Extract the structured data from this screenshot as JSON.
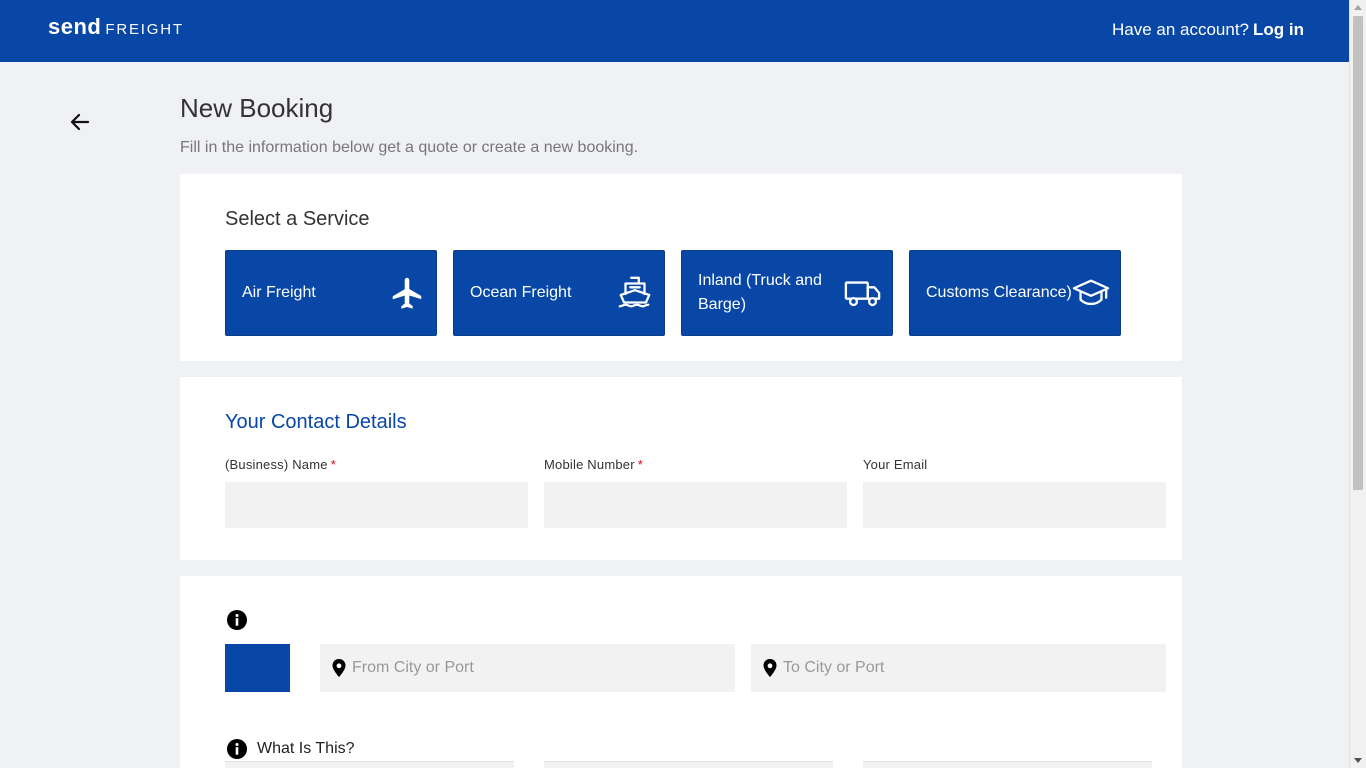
{
  "header": {
    "logo_send": "send",
    "logo_freight": "FREIGHT",
    "account_prompt": "Have an account?",
    "login_label": "Log in"
  },
  "page": {
    "title": "New Booking",
    "subtitle": "Fill in the information below get a quote or create a new booking."
  },
  "services": {
    "title": "Select a Service",
    "items": [
      {
        "label": "Air Freight",
        "icon": "airplane-icon"
      },
      {
        "label": "Ocean Freight",
        "icon": "ship-icon"
      },
      {
        "label": "Inland (Truck and Barge)",
        "icon": "truck-icon"
      },
      {
        "label": "Customs Clearance)",
        "icon": "graduation-cap-icon"
      }
    ]
  },
  "contact": {
    "title": "Your Contact Details",
    "name_label": "(Business) Name",
    "name_value": "",
    "mobile_label": "Mobile Number",
    "mobile_value": "",
    "email_label": "Your Email",
    "email_value": "",
    "required_marker": "*"
  },
  "route": {
    "from_placeholder": "From City or Port",
    "to_placeholder": "To City or Port",
    "what_label": "What Is This?"
  },
  "colors": {
    "brand_blue": "#0847a6",
    "background": "#f0f1f4",
    "field_bg": "#f2f2f2",
    "required": "#d0021b"
  }
}
